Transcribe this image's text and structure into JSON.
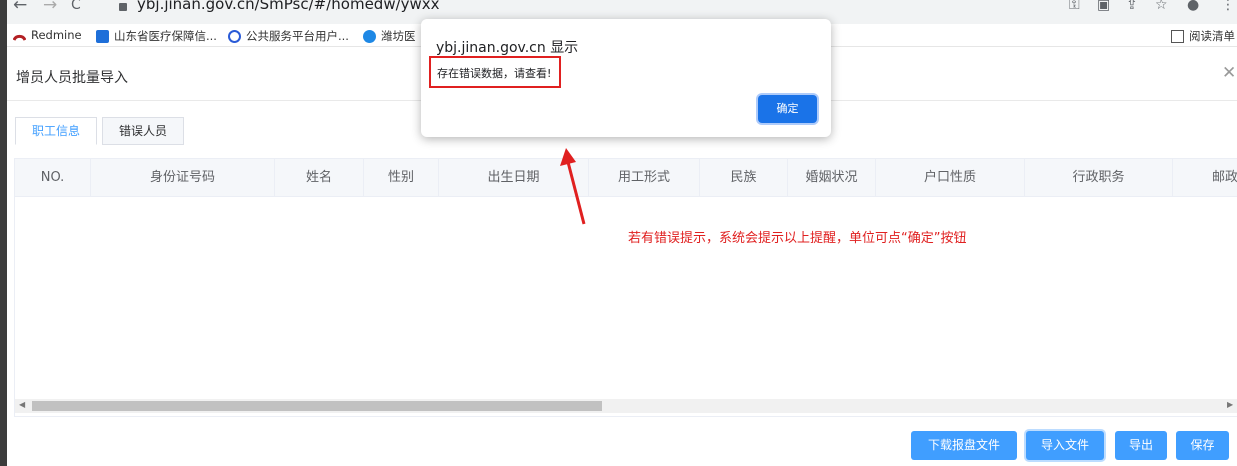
{
  "browser": {
    "url": "ybj.jinan.gov.cn/SmPsc/#/homedw/ywxx",
    "bookmarks": [
      "Redmine",
      "山东省医疗保障信...",
      "公共服务平台用户...",
      "潍坊医"
    ],
    "reading_list": "阅读清单",
    "icons": [
      "back-icon",
      "forward-icon",
      "reload-icon",
      "lock-icon",
      "key-icon",
      "translate-icon",
      "share-icon",
      "star-icon",
      "profile-icon",
      "menu-icon"
    ]
  },
  "page": {
    "title": "增员人员批量导入",
    "tabs": [
      {
        "label": "职工信息",
        "active": true
      },
      {
        "label": "错误人员",
        "active": false
      }
    ],
    "columns": [
      "NO.",
      "身份证号码",
      "姓名",
      "性别",
      "出生日期",
      "用工形式",
      "民族",
      "婚姻状况",
      "户口性质",
      "行政职务",
      "邮政"
    ],
    "buttons": {
      "download": "下载报盘文件",
      "import": "导入文件",
      "export": "导出",
      "save": "保存"
    }
  },
  "dialog": {
    "title": "ybj.jinan.gov.cn 显示",
    "message": "存在错误数据，请查看!",
    "ok": "确定"
  },
  "annotation": "若有错误提示，系统会提示以上提醒，单位可点“确定”按钮",
  "colors": {
    "primary": "#409eff",
    "annotation": "#e02020",
    "dialog_button": "#1a73e8"
  }
}
